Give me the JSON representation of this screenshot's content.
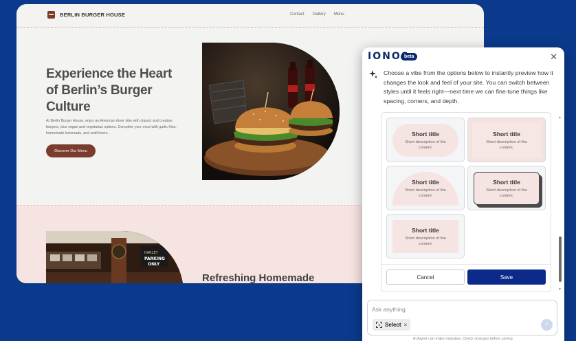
{
  "site": {
    "brand_name": "BERLIN BURGER HOUSE",
    "nav": [
      "Contact",
      "Gallery",
      "Menu"
    ],
    "hero": {
      "title": "Experience the Heart of Berlin’s Burger Culture",
      "description": "At Berlin Burger House, enjoy an American diner vibe with classic and creative burgers, plus vegan and vegetarian options. Complete your meal with garlic fries, homemade lemonade, and craft beers.",
      "button_label": "Discover Our Menu"
    },
    "section2": {
      "title": "Refreshing Homemade",
      "sign_text": "PARKING ONLY"
    },
    "colors": {
      "accent": "#7a3c2e",
      "section_bg": "#f6e4e2",
      "divider": "#e8a7a0"
    }
  },
  "panel": {
    "logo": "IONOS",
    "badge": "beta",
    "close_icon": "close-icon",
    "message": "Choose a vibe from the options below to instantly preview how it changes the look and feel of your site. You can switch between styles until it feels right—next time we can fine-tune things like spacing, corners, and depth.",
    "options": [
      {
        "title": "Short title",
        "description": "Short description of the content."
      },
      {
        "title": "Short title",
        "description": "Short description of the content."
      },
      {
        "title": "Short title",
        "description": "Short description of the content."
      },
      {
        "title": "Short title",
        "description": "Short description of the content."
      },
      {
        "title": "Short title",
        "description": "Short description of the content."
      }
    ],
    "cancel_label": "Cancel",
    "save_label": "Save",
    "input_placeholder": "Ask anything",
    "chip_label": "Select",
    "chip_close": "×",
    "send_icon": "↑",
    "disclaimer": "AI Agent can make mistakes. Check changes before saving.",
    "colors": {
      "primary": "#0b2a8a",
      "logo": "#0b2a6e"
    }
  }
}
